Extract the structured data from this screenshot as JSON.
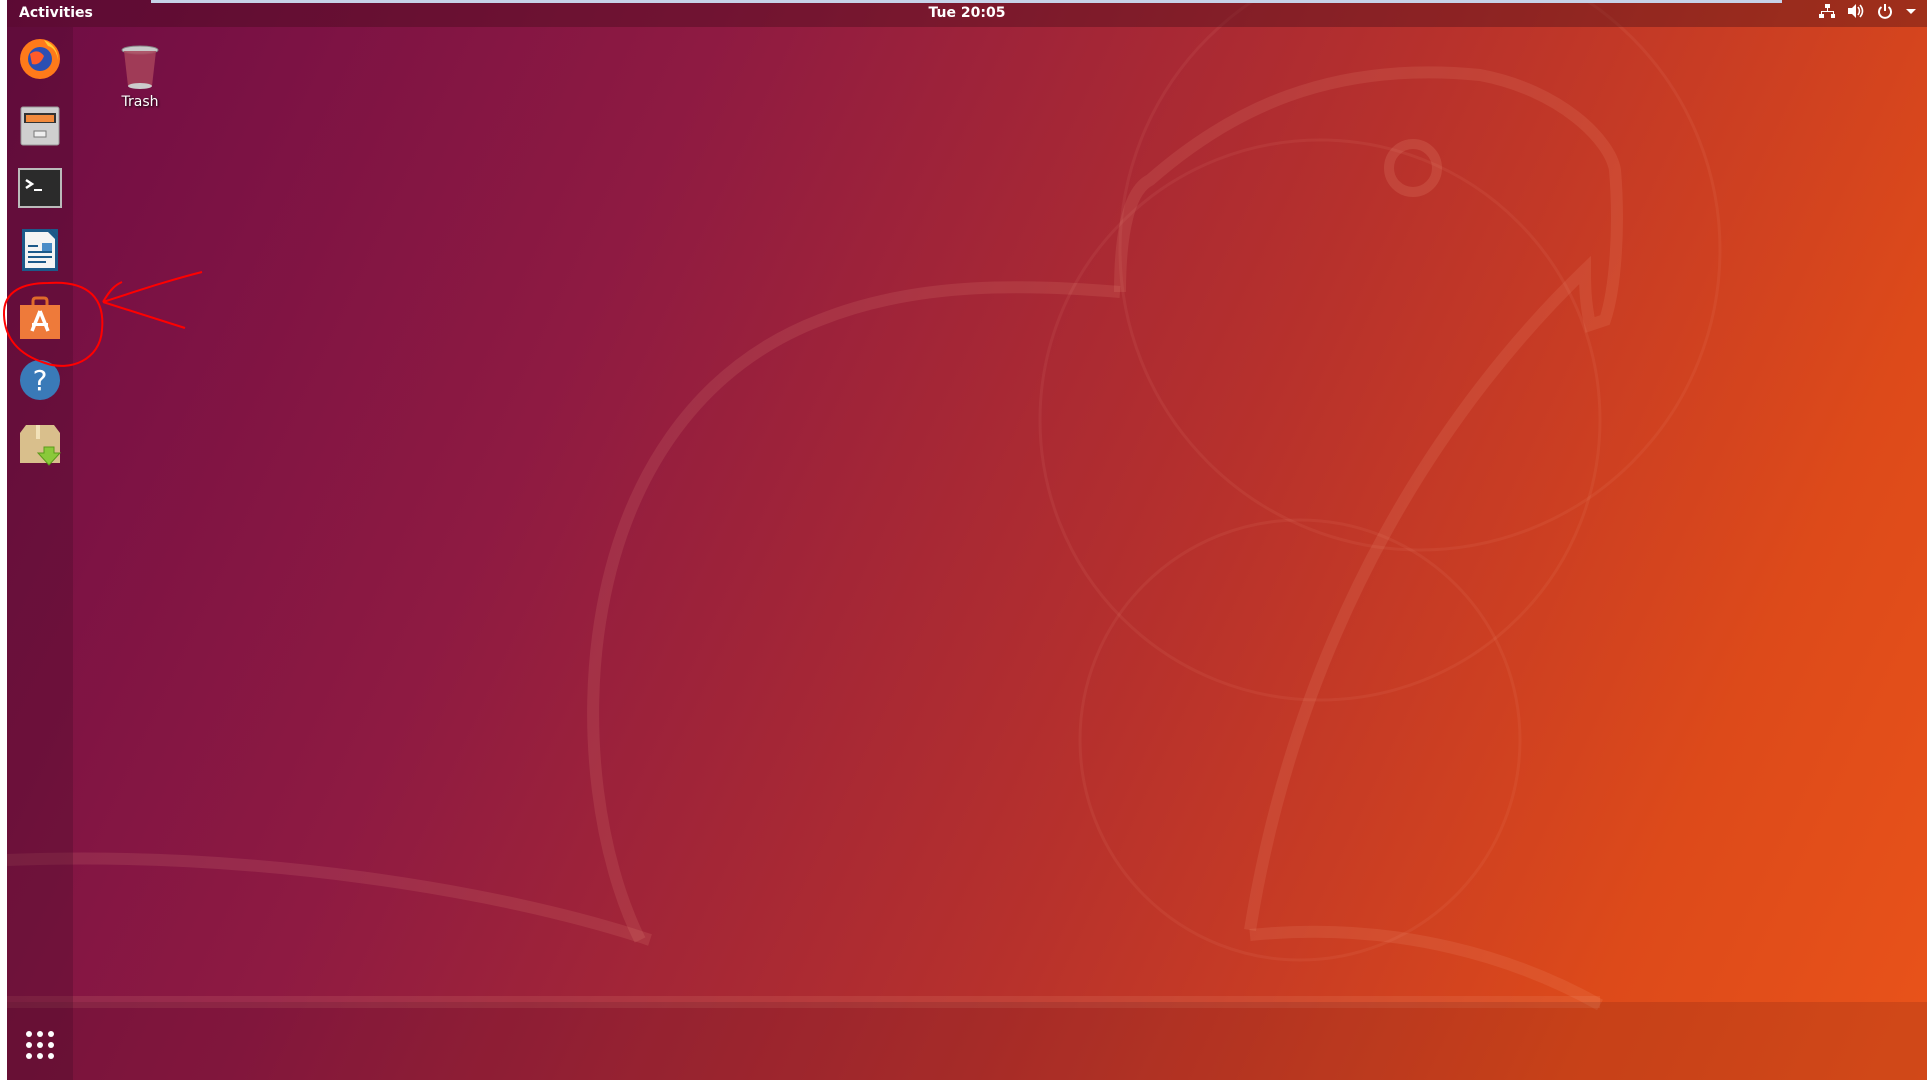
{
  "topbar": {
    "activities_label": "Activities",
    "clock": "Tue 20:05",
    "tray_icons": [
      "network-icon",
      "volume-icon",
      "power-icon",
      "dropdown-arrow-icon"
    ]
  },
  "dock": {
    "items": [
      {
        "name": "Firefox Web Browser",
        "icon": "firefox-icon"
      },
      {
        "name": "Files",
        "icon": "files-icon"
      },
      {
        "name": "Terminal",
        "icon": "terminal-icon"
      },
      {
        "name": "LibreOffice Writer",
        "icon": "writer-icon"
      },
      {
        "name": "Ubuntu Software",
        "icon": "software-center-icon",
        "annotated": true
      },
      {
        "name": "Help",
        "icon": "help-icon"
      },
      {
        "name": "Archive",
        "icon": "package-download-icon"
      }
    ],
    "show_apps_icon": "app-grid-icon"
  },
  "desktop": {
    "icons": [
      {
        "label": "Trash",
        "icon": "trash-icon"
      }
    ]
  },
  "annotation": {
    "color": "#ff0000",
    "target": "Ubuntu Software"
  }
}
